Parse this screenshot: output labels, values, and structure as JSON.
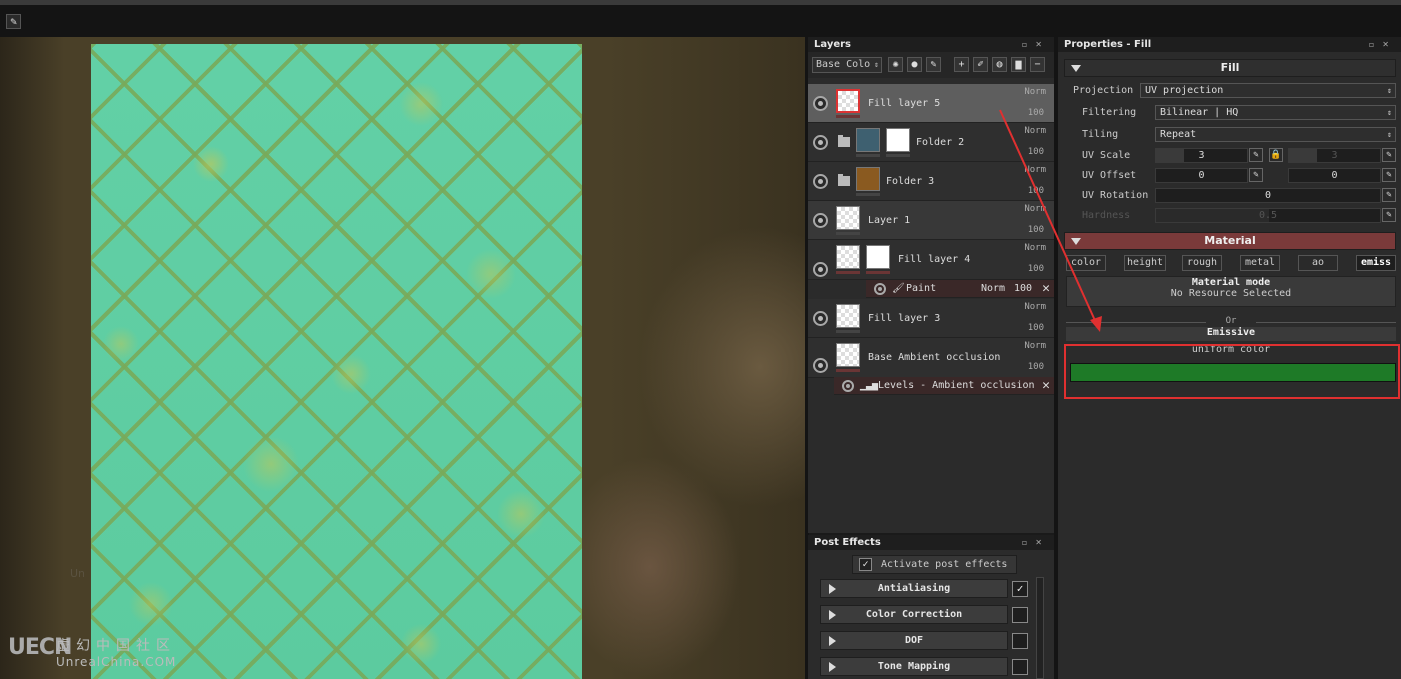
{
  "toolbar": {
    "brush_icon": "pencil-icon"
  },
  "viewport": {
    "watermark_logo": "UECN",
    "watermark_cn": "虚幻中国社区",
    "watermark_en": "UnrealChina.COM",
    "ghost_text": "Un"
  },
  "layers_panel": {
    "title": "Layers",
    "channel_select": "Base Colo",
    "layers": [
      {
        "name": "Fill layer 5",
        "blend": "Norm",
        "opacity": "100"
      },
      {
        "name": "Folder 2",
        "blend": "Norm",
        "opacity": "100"
      },
      {
        "name": "Folder 3",
        "blend": "Norm",
        "opacity": "100"
      },
      {
        "name": "Layer 1",
        "blend": "Norm",
        "opacity": "100"
      },
      {
        "name": "Fill layer 4",
        "blend": "Norm",
        "opacity": "100"
      },
      {
        "name": "Fill layer 3",
        "blend": "Norm",
        "opacity": "100"
      },
      {
        "name": "Base Ambient occlusion",
        "blend": "Norm",
        "opacity": "100"
      }
    ],
    "paint_effect": {
      "label": "Paint",
      "blend": "Norm",
      "opacity": "100"
    },
    "levels_effect": {
      "label": "Levels - Ambient occlusion"
    }
  },
  "post_effects": {
    "title": "Post Effects",
    "activate_label": "Activate post effects",
    "effects": [
      {
        "label": "Antialiasing",
        "checked": true
      },
      {
        "label": "Color Correction",
        "checked": false
      },
      {
        "label": "DOF",
        "checked": false
      },
      {
        "label": "Tone Mapping",
        "checked": false
      }
    ]
  },
  "properties": {
    "title": "Properties - Fill",
    "fill_section": "Fill",
    "projection_label": "Projection",
    "projection_value": "UV projection",
    "filtering_label": "Filtering",
    "filtering_value": "Bilinear | HQ",
    "tiling_label": "Tiling",
    "tiling_value": "Repeat",
    "uv_scale_label": "UV Scale",
    "uv_scale_u": "3",
    "uv_scale_v": "3",
    "uv_offset_label": "UV Offset",
    "uv_offset_u": "0",
    "uv_offset_v": "0",
    "uv_rotation_label": "UV Rotation",
    "uv_rotation_value": "0",
    "hardness_label": "Hardness",
    "hardness_value": "0.5",
    "material_section": "Material",
    "channels": [
      "color",
      "height",
      "rough",
      "metal",
      "ao",
      "emiss"
    ],
    "material_mode_title": "Material mode",
    "material_mode_value": "No Resource Selected",
    "or_label": "Or",
    "emissive_title": "Emissive",
    "emissive_mode": "uniform color",
    "emissive_color": "#1e7a27"
  },
  "colors": {
    "accent_red": "#e03030",
    "material_bar": "#7a3a3a"
  }
}
